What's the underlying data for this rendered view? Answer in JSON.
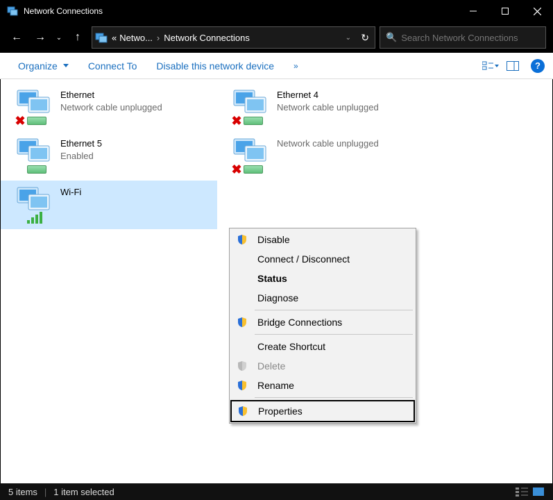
{
  "window": {
    "title": "Network Connections"
  },
  "breadcrumb": {
    "prefix": "«",
    "seg1": "Netwo...",
    "seg2": "Network Connections"
  },
  "search": {
    "placeholder": "Search Network Connections"
  },
  "toolbar": {
    "organize": "Organize",
    "connect": "Connect To",
    "disable": "Disable this network device",
    "more": "»"
  },
  "connections": [
    {
      "name": "Ethernet",
      "sub": "Network cable unplugged",
      "status": "unplugged",
      "selected": false
    },
    {
      "name": "Ethernet 4",
      "sub": "Network cable unplugged",
      "status": "unplugged",
      "selected": false
    },
    {
      "name": "Ethernet 5",
      "sub": "Enabled",
      "status": "enabled",
      "selected": false
    },
    {
      "name": "",
      "sub": "Network cable unplugged",
      "status": "unplugged",
      "selected": false
    },
    {
      "name": "Wi-Fi",
      "sub": "",
      "status": "wifi",
      "selected": true
    }
  ],
  "context_menu": [
    {
      "label": "Disable",
      "icon": "shield",
      "bold": false,
      "disabled": false,
      "sep_after": false,
      "highlight": false
    },
    {
      "label": "Connect / Disconnect",
      "icon": "",
      "bold": false,
      "disabled": false,
      "sep_after": false,
      "highlight": false
    },
    {
      "label": "Status",
      "icon": "",
      "bold": true,
      "disabled": false,
      "sep_after": false,
      "highlight": false
    },
    {
      "label": "Diagnose",
      "icon": "",
      "bold": false,
      "disabled": false,
      "sep_after": true,
      "highlight": false
    },
    {
      "label": "Bridge Connections",
      "icon": "shield",
      "bold": false,
      "disabled": false,
      "sep_after": true,
      "highlight": false
    },
    {
      "label": "Create Shortcut",
      "icon": "",
      "bold": false,
      "disabled": false,
      "sep_after": false,
      "highlight": false
    },
    {
      "label": "Delete",
      "icon": "shield",
      "bold": false,
      "disabled": true,
      "sep_after": false,
      "highlight": false
    },
    {
      "label": "Rename",
      "icon": "shield",
      "bold": false,
      "disabled": false,
      "sep_after": true,
      "highlight": false
    },
    {
      "label": "Properties",
      "icon": "shield",
      "bold": false,
      "disabled": false,
      "sep_after": false,
      "highlight": true
    }
  ],
  "statusbar": {
    "count": "5 items",
    "selection": "1 item selected"
  }
}
